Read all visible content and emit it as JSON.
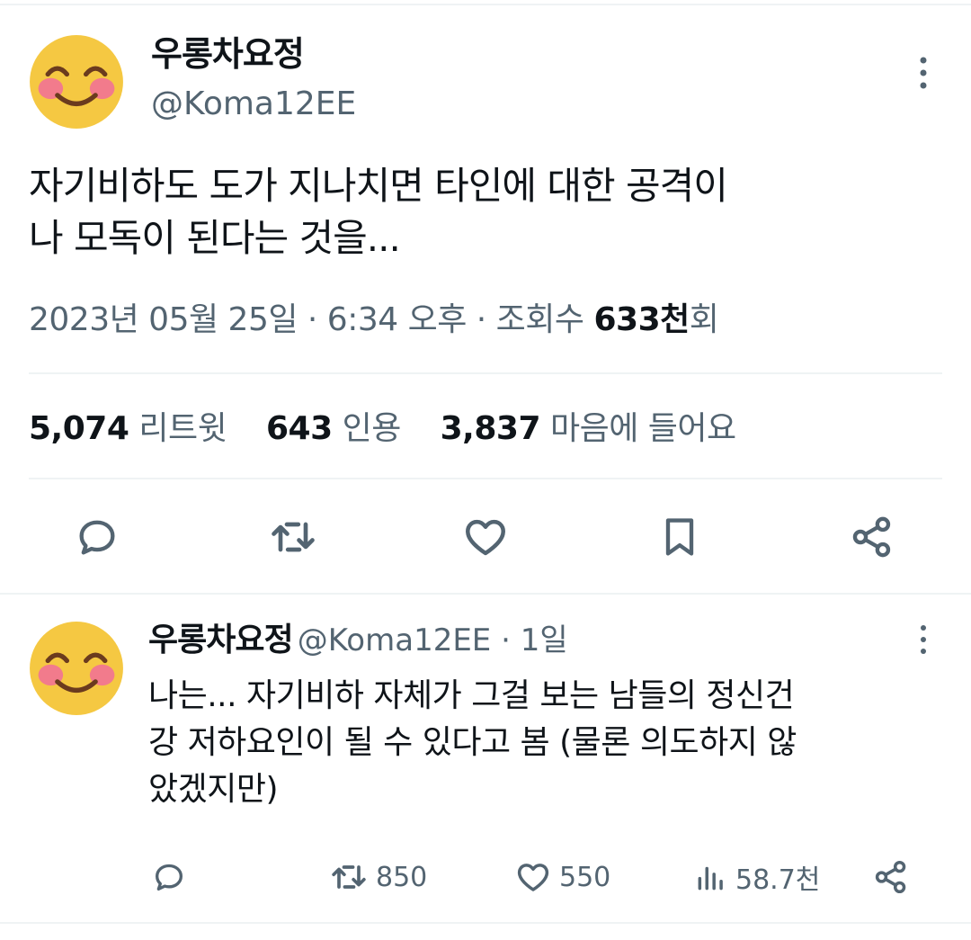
{
  "main_tweet": {
    "author_name": "우롱차요정",
    "author_handle": "@Koma12EE",
    "text_line1": "자기비하도 도가 지나치면 타인에 대한 공격이",
    "text_line2": "나 모독이 된다는 것을...",
    "meta_date": "2023년 05월 25일 · 6:34 오후 · 조회수 ",
    "meta_views_value": "633천",
    "meta_views_suffix": "회",
    "retweets_count": "5,074",
    "retweets_label": "리트윗",
    "quotes_count": "643",
    "quotes_label": "인용",
    "likes_count": "3,837",
    "likes_label": "마음에 들어요"
  },
  "reply": {
    "author_name": "우롱차요정",
    "author_handle": "@Koma12EE · 1일",
    "text_line1": "나는... 자기비하 자체가 그걸 보는 남들의 정신건",
    "text_line2": "강 저하요인이 될 수 있다고 봄 (물론 의도하지 않",
    "text_line3": "았겠지만)",
    "retweets": "850",
    "likes": "550",
    "views": "58.7천"
  },
  "colors": {
    "text": "#0f1419",
    "secondary": "#536471",
    "divider": "#eff3f4",
    "avatar": "#f5c842",
    "cheek": "#f27b8c"
  },
  "icons": [
    "emoji-avatar",
    "more-icon",
    "reply-icon",
    "retweet-icon",
    "like-icon",
    "bookmark-icon",
    "share-icon",
    "views-icon"
  ]
}
